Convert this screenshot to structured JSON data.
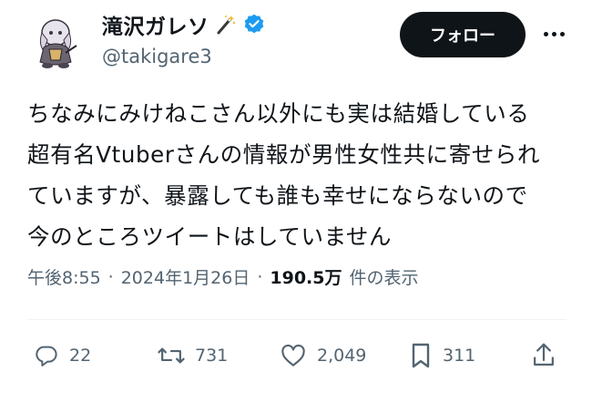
{
  "header": {
    "display_name": "滝沢ガレソ",
    "handle": "@takigare3",
    "follow_label": "フォロー"
  },
  "tweet": {
    "lines": [
      "ちなみにみけねこさん以外にも実は結婚している",
      "超有名Vtuberさんの情報が男性女性共に寄せられ",
      "ていますが、暴露しても誰も幸せにならないので",
      "今のところツイートはしていません"
    ]
  },
  "meta": {
    "time": "午後8:55",
    "separator": "·",
    "date": "2024年1月26日",
    "views": "190.5万",
    "views_label": "件の表示"
  },
  "actions": {
    "replies": "22",
    "retweets": "731",
    "likes": "2,049",
    "bookmarks": "311"
  },
  "colors": {
    "verified": "#1d9bf0",
    "secondary_text": "#536471",
    "follow_bg": "#0f1419"
  },
  "icons": [
    "wand-icon",
    "verified-badge-icon",
    "more-icon",
    "reply-icon",
    "retweet-icon",
    "like-icon",
    "bookmark-icon",
    "share-icon"
  ]
}
